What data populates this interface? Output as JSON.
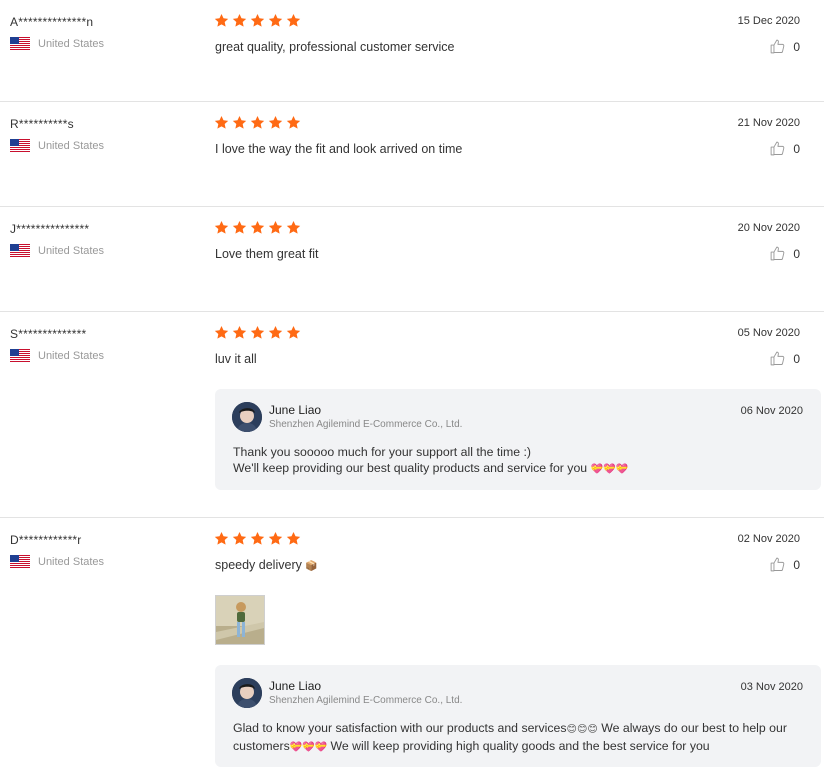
{
  "reviews": [
    {
      "author": "A**************n",
      "country": "United States",
      "rating": 5,
      "comment": "great quality, professional customer service",
      "date": "15 Dec 2020",
      "likes": "0"
    },
    {
      "author": "R**********s",
      "country": "United States",
      "rating": 5,
      "comment": "I love the way the fit and look arrived on time",
      "date": "21 Nov 2020",
      "likes": "0"
    },
    {
      "author": "J***************",
      "country": "United States",
      "rating": 5,
      "comment": "Love them great fit",
      "date": "20 Nov 2020",
      "likes": "0"
    },
    {
      "author": "S**************",
      "country": "United States",
      "rating": 5,
      "comment": "luv it all",
      "date": "05 Nov 2020",
      "likes": "0",
      "reply": {
        "name": "June Liao",
        "company": "Shenzhen Agilemind E-Commerce Co., Ltd.",
        "date": "06 Nov 2020",
        "line1": "Thank you sooooo much for your support all the time :)",
        "line2": "We'll keep providing our best quality products and service for you",
        "line2_emoji": "💝💝💝"
      }
    },
    {
      "author": "D************r",
      "country": "United States",
      "rating": 5,
      "comment": "speedy delivery",
      "comment_emoji": "📦",
      "date": "02 Nov 2020",
      "likes": "0",
      "reply": {
        "name": "June Liao",
        "company": "Shenzhen Agilemind E-Commerce Co., Ltd.",
        "date": "03 Nov 2020",
        "line1": "Glad to know your satisfaction with our products and services",
        "line1_emoji": "😊😊😊",
        "line1_tail": "We always do our best to help our",
        "line2": "customers",
        "line2_emoji": "💝💝💝",
        "line2_tail": "We will keep providing high quality goods and the best service for you"
      }
    }
  ],
  "colors": {
    "star": "#ff6a14",
    "divider": "#e3e3e3",
    "reply_bg": "#f2f3f5"
  },
  "icons": {
    "star": "star-icon",
    "flag": "us-flag-icon",
    "like": "thumbs-up-icon"
  }
}
